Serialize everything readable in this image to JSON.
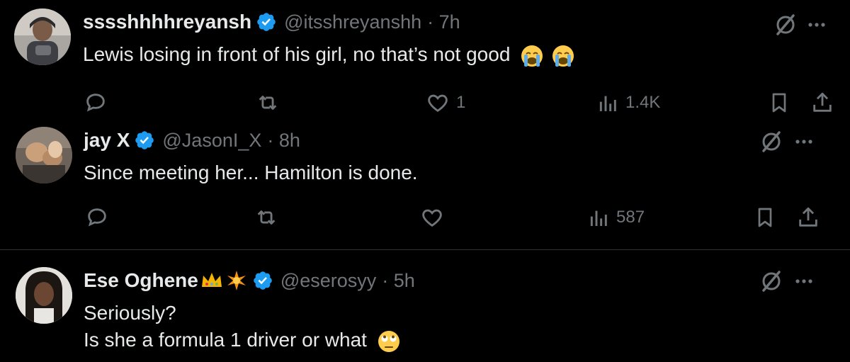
{
  "tweets": [
    {
      "name": "sssshhhhreyansh",
      "handle": "@itsshreyanshh",
      "time": "· 7h",
      "text": "Lewis losing in front of his girl, no that’s not good",
      "emoji": "loudly-crying-face x2",
      "actions": {
        "reply": "",
        "retweet": "",
        "like": "1",
        "views": "1.4K"
      }
    },
    {
      "name": "jay X",
      "handle": "@JasonI_X",
      "time": "· 8h",
      "text": "Since meeting her... Hamilton is done.",
      "actions": {
        "reply": "",
        "retweet": "",
        "like": "",
        "views": "587"
      }
    },
    {
      "name": "Ese Oghene",
      "name_emojis": "crown, sparkle",
      "handle": "@eserosyy",
      "time": "· 5h",
      "text_line1": "Seriously?",
      "text_line2": "Is she a formula 1 driver or what",
      "emoji": "face-with-rolling-eyes"
    }
  ],
  "colors": {
    "background": "#000000",
    "text": "#e7e9ea",
    "muted": "#71767b",
    "verified": "#1d9bf0",
    "divider": "#2f3336"
  }
}
